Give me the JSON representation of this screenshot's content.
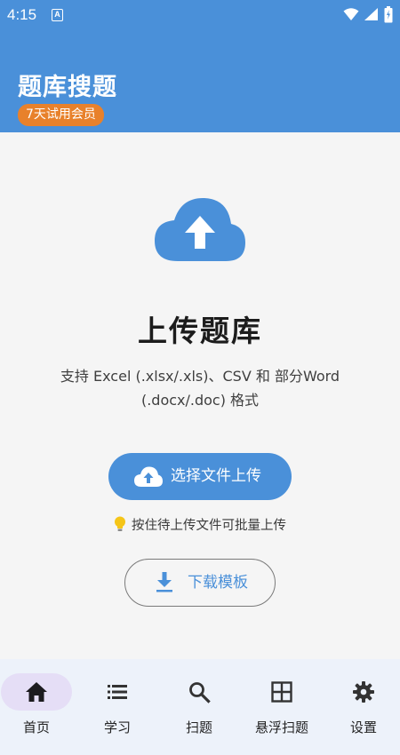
{
  "status_bar": {
    "time": "4:15",
    "notification_icon": "A"
  },
  "header": {
    "title": "题库搜题",
    "badge": "7天试用会员"
  },
  "main": {
    "heading": "上传题库",
    "description": "支持 Excel (.xlsx/.xls)、CSV 和 部分Word (.docx/.doc) 格式",
    "upload_button": "选择文件上传",
    "tip": "按住待上传文件可批量上传",
    "download_button": "下载模板"
  },
  "bottom_nav": [
    {
      "label": "首页",
      "icon": "home-icon",
      "active": true
    },
    {
      "label": "学习",
      "icon": "list-icon",
      "active": false
    },
    {
      "label": "扫题",
      "icon": "search-icon",
      "active": false
    },
    {
      "label": "悬浮扫题",
      "icon": "grid-icon",
      "active": false
    },
    {
      "label": "设置",
      "icon": "gear-icon",
      "active": false
    }
  ],
  "colors": {
    "primary": "#4a90d9",
    "badge": "#e8812b",
    "nav_active": "#e5def6"
  }
}
